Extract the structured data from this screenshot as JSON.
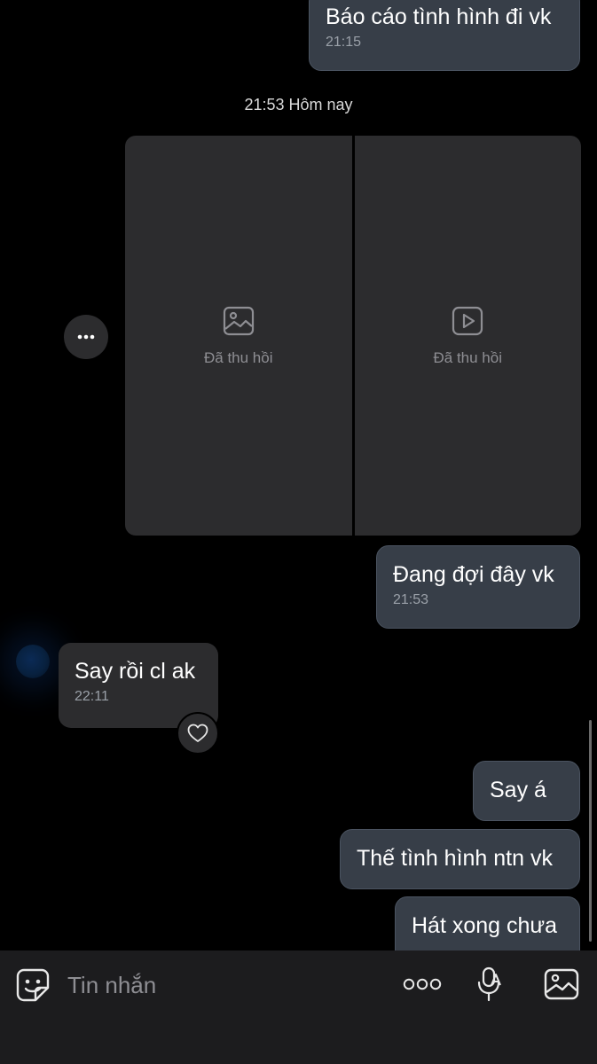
{
  "messages": [
    {
      "text": "Báo cáo tình hình đi vk",
      "time": "21:15"
    },
    {
      "text": "Đang đợi đây vk",
      "time": "21:53"
    },
    {
      "text": "Say rồi cl ak",
      "time": "22:11"
    },
    {
      "text": "Say á"
    },
    {
      "text": "Thế tình hình ntn vk"
    },
    {
      "text": "Hát xong chưa"
    }
  ],
  "date_separator": "21:53 Hôm nay",
  "media": {
    "image_label": "Đã thu hồi",
    "video_label": "Đã thu hồi",
    "image_icon": "image-icon",
    "video_icon": "video-play-icon"
  },
  "composer": {
    "placeholder": "Tin nhắn",
    "icons": [
      "sticker-icon",
      "more-options-icon",
      "voice-mic-icon",
      "gallery-icon"
    ]
  },
  "colors": {
    "background": "#000000",
    "outgoing_bubble": "#373e48",
    "incoming_bubble": "#2c2c2e",
    "composer_bar": "#1c1c1e"
  }
}
